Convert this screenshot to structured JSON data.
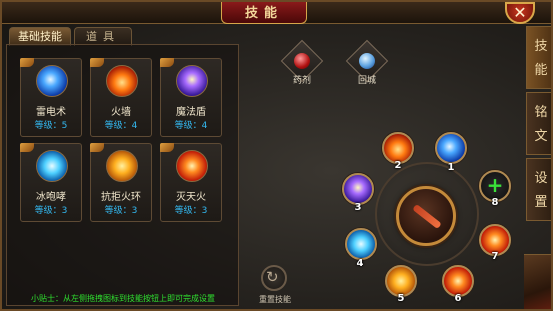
{
  "window": {
    "title": "技能",
    "close_label": "✕"
  },
  "tabs": [
    {
      "label": "基础技能",
      "active": true
    },
    {
      "label": "道具",
      "active": false
    }
  ],
  "skills": [
    {
      "name": "雷电术",
      "level": "等级：5",
      "icon": "lightning-orb-icon"
    },
    {
      "name": "火墙",
      "level": "等级：4",
      "icon": "fire-wall-icon"
    },
    {
      "name": "魔法盾",
      "level": "等级：4",
      "icon": "magic-shield-icon"
    },
    {
      "name": "冰咆哮",
      "level": "等级：3",
      "icon": "ice-roar-icon"
    },
    {
      "name": "抗拒火环",
      "level": "等级：3",
      "icon": "fire-ring-icon"
    },
    {
      "name": "灭天火",
      "level": "等级：3",
      "icon": "heaven-fire-icon"
    }
  ],
  "tip": "小贴士：从左侧拖拽图标到技能按钮上即可完成设置",
  "items": [
    {
      "label": "药剂",
      "icon": "potion-icon"
    },
    {
      "label": "回城",
      "icon": "return-town-icon"
    }
  ],
  "radial_slots": [
    {
      "num": "1",
      "icon": "lightning-orb-icon"
    },
    {
      "num": "2",
      "icon": "fire-wall-icon"
    },
    {
      "num": "3",
      "icon": "magic-shield-icon"
    },
    {
      "num": "4",
      "icon": "ice-roar-icon"
    },
    {
      "num": "5",
      "icon": "fire-ring-icon"
    },
    {
      "num": "6",
      "icon": "heaven-fire-icon"
    },
    {
      "num": "7",
      "icon": "fireball-icon"
    },
    {
      "num": "8",
      "icon": "add-icon"
    }
  ],
  "reset_label": "重置技能",
  "side_tabs": [
    {
      "label": "技能",
      "active": true
    },
    {
      "label": "铭文",
      "active": false
    },
    {
      "label": "设置",
      "active": false
    }
  ],
  "colors": {
    "level_text": "#33b8f0",
    "tip_text": "#2fe02f",
    "accent_gold": "#c48a3a"
  }
}
